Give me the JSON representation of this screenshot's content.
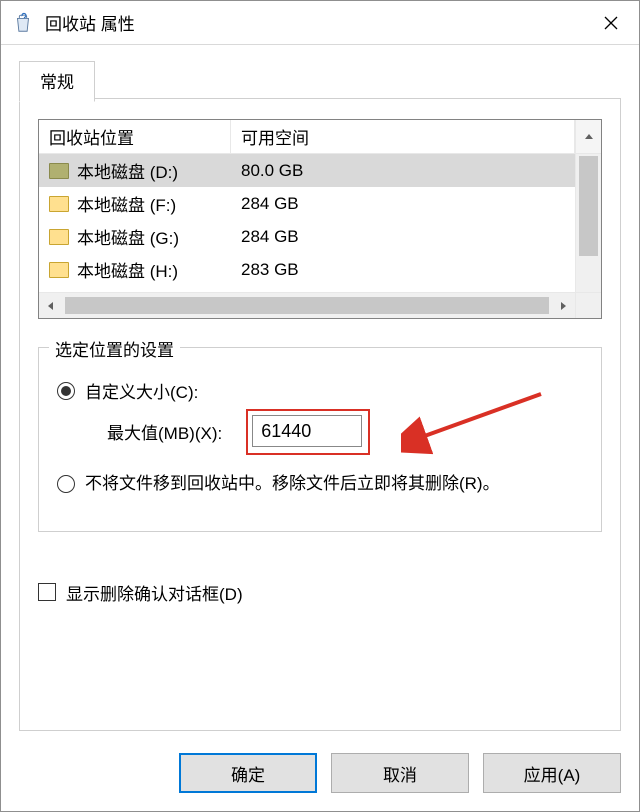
{
  "title": "回收站 属性",
  "tab": {
    "label": "常规"
  },
  "listview": {
    "columns": {
      "location": "回收站位置",
      "space": "可用空间"
    },
    "rows": [
      {
        "name": "本地磁盘 (D:)",
        "space": "80.0 GB",
        "selected": true,
        "iconVariant": "olive"
      },
      {
        "name": "本地磁盘 (F:)",
        "space": "284 GB",
        "selected": false,
        "iconVariant": "yellow"
      },
      {
        "name": "本地磁盘 (G:)",
        "space": "284 GB",
        "selected": false,
        "iconVariant": "yellow"
      },
      {
        "name": "本地磁盘 (H:)",
        "space": "283 GB",
        "selected": false,
        "iconVariant": "yellow"
      }
    ]
  },
  "group": {
    "legend": "选定位置的设置",
    "customSize": {
      "label": "自定义大小(C):",
      "checked": true
    },
    "maxValue": {
      "label": "最大值(MB)(X):",
      "value": "61440"
    },
    "noRecycle": {
      "label": "不将文件移到回收站中。移除文件后立即将其删除(R)。",
      "checked": false
    }
  },
  "confirmDelete": {
    "label": "显示删除确认对话框(D)",
    "checked": false
  },
  "buttons": {
    "ok": "确定",
    "cancel": "取消",
    "apply": "应用(A)"
  }
}
